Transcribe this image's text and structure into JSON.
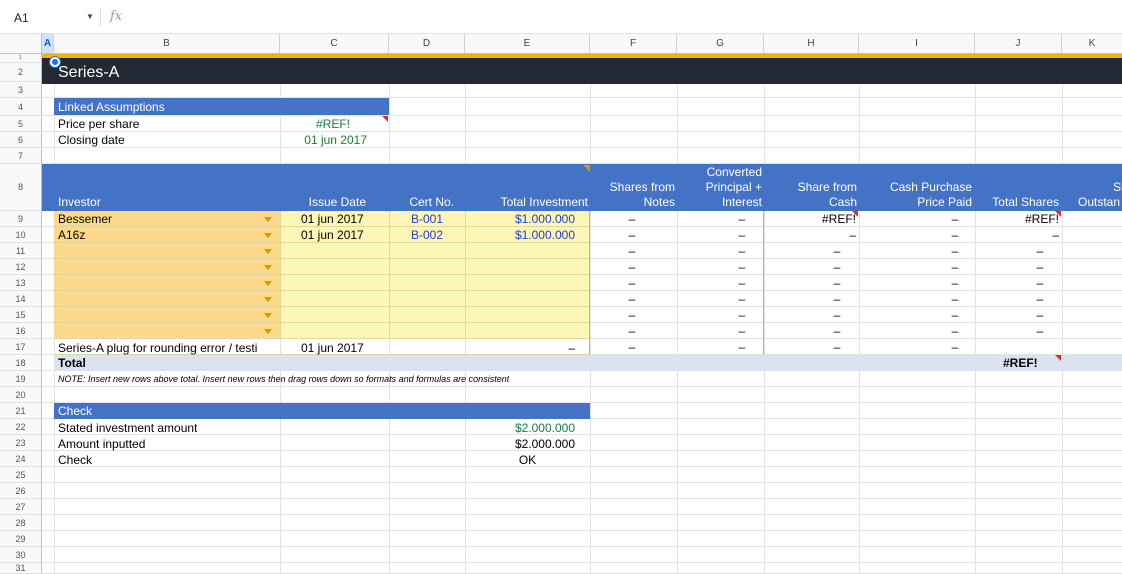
{
  "formula_bar": {
    "cell_ref": "A1",
    "fx": "fx"
  },
  "columns": [
    "A",
    "B",
    "C",
    "D",
    "E",
    "F",
    "G",
    "H",
    "I",
    "J",
    "K"
  ],
  "rows": [
    "1",
    "2",
    "3",
    "4",
    "5",
    "6",
    "7",
    "8",
    "9",
    "10",
    "11",
    "12",
    "13",
    "14",
    "15",
    "16",
    "17",
    "18",
    "19",
    "20",
    "21",
    "22",
    "23",
    "24",
    "25",
    "26",
    "27",
    "28",
    "29",
    "30",
    "31"
  ],
  "sheet_title": "Series-A",
  "linked_assumptions": {
    "header": "Linked Assumptions",
    "price_label": "Price per share",
    "price_value": "#REF!",
    "closing_label": "Closing date",
    "closing_value": "01 jun 2017"
  },
  "table_headers": {
    "investor": "Investor",
    "issue_date": "Issue Date",
    "cert_no": "Cert No.",
    "total_investment": "Total Investment",
    "shares_from_notes_1": "Shares from",
    "shares_from_notes_2": "Notes",
    "converted_1": "Converted",
    "converted_2": "Principal +",
    "converted_3": "Interest",
    "share_from_cash_1": "Share from",
    "share_from_cash_2": "Cash",
    "cash_purchase_1": "Cash Purchase",
    "cash_purchase_2": "Price Paid",
    "total_shares": "Total Shares",
    "outstanding_1": "Sh",
    "outstanding_2": "Outstan"
  },
  "investors": [
    {
      "name": "Bessemer",
      "issue_date": "01 jun 2017",
      "cert": "B-001",
      "investment": "$1.000.000",
      "notes": "–",
      "converted": "–",
      "cash": "#REF!",
      "price_paid": "–",
      "total": "#REF!"
    },
    {
      "name": "A16z",
      "issue_date": "01 jun 2017",
      "cert": "B-002",
      "investment": "$1.000.000",
      "notes": "–",
      "converted": "–",
      "cash": "–",
      "price_paid": "–",
      "total": "–"
    }
  ],
  "dash": "–",
  "plug_row": {
    "label": "Series-A plug for rounding error / testi",
    "date": "01 jun 2017",
    "investment": "–"
  },
  "total_row": {
    "label": "Total",
    "total_shares": "#REF!"
  },
  "note": "NOTE: Insert new rows above total. Insert new rows then drag rows down so formats and formulas are consistent",
  "check": {
    "header": "Check",
    "stated_label": "Stated investment amount",
    "stated_value": "$2.000.000",
    "inputted_label": "Amount inputted",
    "inputted_value": "$2.000.000",
    "check_label": "Check",
    "check_value": "OK"
  }
}
